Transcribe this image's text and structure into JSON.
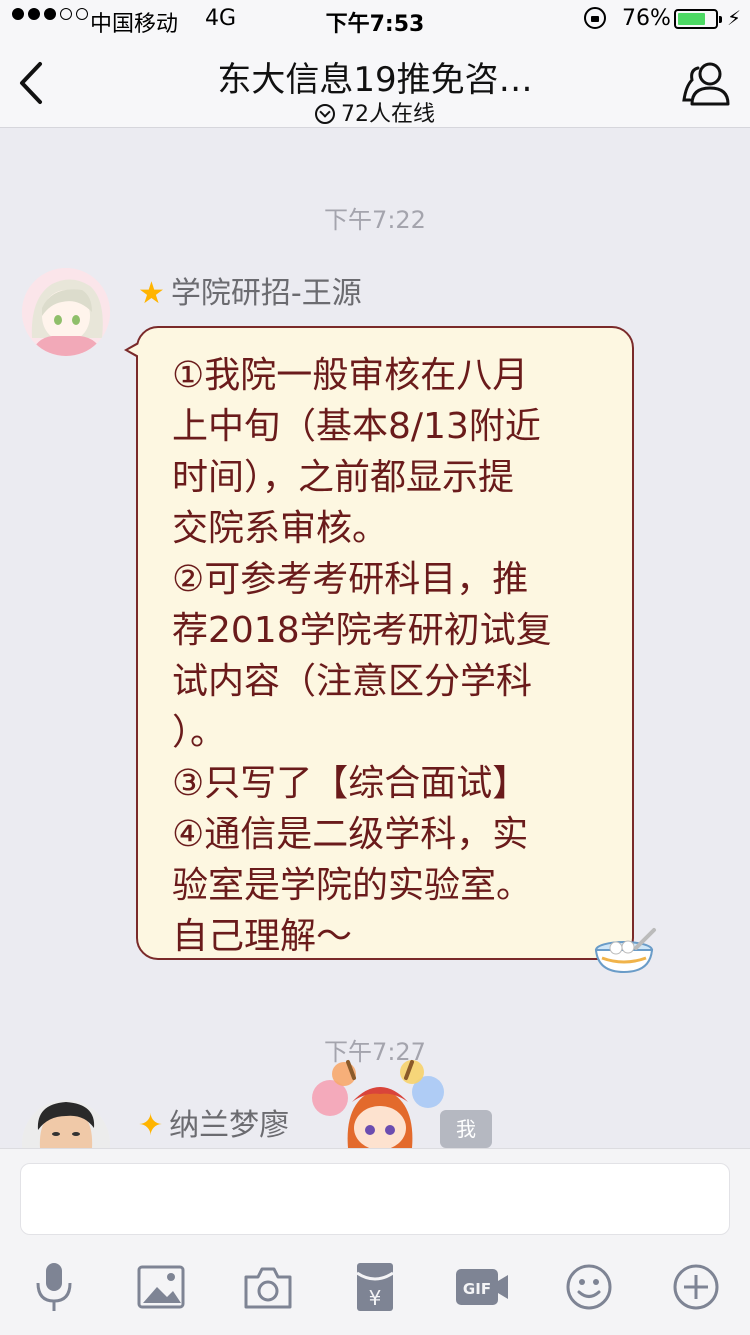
{
  "status_bar": {
    "carrier": "中国移动",
    "network": "4G",
    "time": "下午7:53",
    "battery_percent": "76%",
    "battery_level": 0.76,
    "battery_color": "#4cd964"
  },
  "nav": {
    "title": "东大信息19推免咨…",
    "online_count": "72人在线",
    "back_icon": "chevron-left-icon",
    "members_icon": "group-members-icon"
  },
  "messages": [
    {
      "timestamp": "下午7:22",
      "sender": "学院研招-王源",
      "sender_badge": "star-icon",
      "lines": [
        "①我院一般审核在八月",
        "上中旬（基本8/13附近",
        "时间），之前都显示提",
        "交院系审核。",
        "②可参考考研科目，推",
        "荐2018学院考研初试复",
        "试内容（注意区分学科",
        "）。",
        "③只写了【综合面试】",
        "④通信是二级学科，实",
        "验室是学院的实验室。",
        "自己理解～"
      ],
      "bubble_color": "#fdf7e1",
      "bubble_border": "#7a2a2a",
      "text_color": "#6a1b1b"
    },
    {
      "timestamp": "下午7:27",
      "sender": "纳兰梦廖",
      "sender_badge": "diamond-star-icon",
      "me_badge": "我"
    }
  ],
  "input": {
    "placeholder": "",
    "toolbar": [
      "microphone-icon",
      "image-icon",
      "camera-icon",
      "red-packet-icon",
      "gif-icon",
      "emoji-icon",
      "plus-icon"
    ]
  }
}
